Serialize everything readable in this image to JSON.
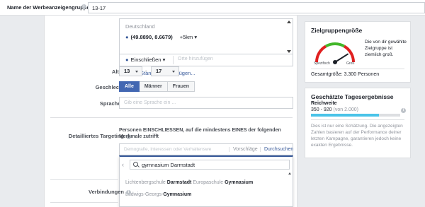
{
  "topbar": {
    "name_label": "Name der Werbeanzeigengruppe",
    "name_value": "13-17",
    "info": "i"
  },
  "location": {
    "country": "Deutschland",
    "coords": "(49.8890, 8.6679)",
    "radius": "+5km",
    "include_label": "Einschließen",
    "search_placeholder": "Orte hinzufügen",
    "add_more": "Mehrere Standorte hinzufügen..."
  },
  "age": {
    "label": "Alter",
    "min": "13",
    "max": "17",
    "separator": "-"
  },
  "gender": {
    "label": "Geschlecht",
    "options": [
      "Alle",
      "Männer",
      "Frauen"
    ],
    "selected": "Alle"
  },
  "languages": {
    "label": "Sprachen",
    "placeholder": "Gib eine Sprache ein ..."
  },
  "detailed": {
    "label": "Detailliertes Targeting",
    "description": "Personen EINSCHLIESSEN, auf die mindestens EINES der folgenden Merkmale zutrifft",
    "placeholder": "Demografie, Interessen oder Verhaltenswe",
    "suggestions": "Vorschläge",
    "browse": "Durchsuchen",
    "search_value": "gymnasium Darmstadt",
    "results": [
      {
        "parts": [
          {
            "t": "Lichtenbergschule ",
            "b": false
          },
          {
            "t": "Darmstadt",
            "b": true
          },
          {
            "t": " Europaschule ",
            "b": false
          },
          {
            "t": "Gymnasium",
            "b": true
          }
        ]
      },
      {
        "parts": [
          {
            "t": "Ludwigs-Georgs-",
            "b": false
          },
          {
            "t": "Gymnasium",
            "b": true
          }
        ]
      }
    ]
  },
  "connections": {
    "label": "Verbindungen"
  },
  "audience_size": {
    "title": "Zielgruppengröße",
    "description": "Die von dir gewählte Zielgruppe ist ziemlich groß.",
    "specific_label": "Spezifisch",
    "broad_label": "Groß",
    "gauge_level": 0.82,
    "total": "Gesamtgröße: 3.300 Personen"
  },
  "daily_results": {
    "title": "Geschätzte Tagesergebnisse",
    "reach_label": "Reichweite",
    "reach_value": "350 - 920",
    "reach_of": "(von 2.000)",
    "reach_fraction": 0.76,
    "note": "Dies ist nur eine Schätzung. Die angezeigten Zahlen basieren auf der Performance deiner letzten Kampagne, garantieren jedoch keine exakten Ergebnisse."
  }
}
